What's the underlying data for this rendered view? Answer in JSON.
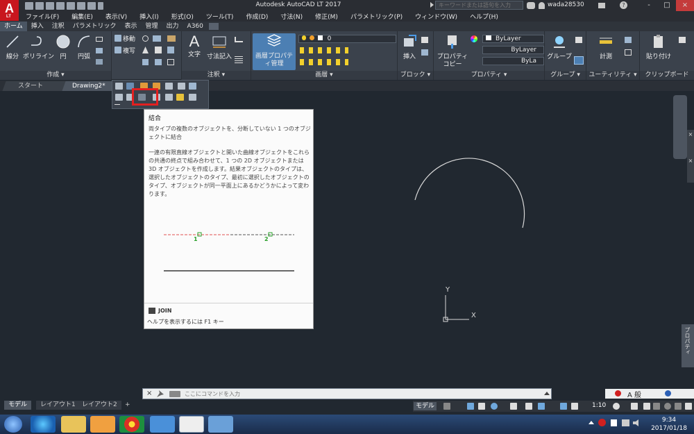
{
  "title_bar": {
    "app_logo": "A",
    "app_logo_sub": "LT",
    "window_title": "Autodesk AutoCAD LT 2017",
    "search_placeholder": "キーワードまたは語句を入力",
    "user_name": "wada28530",
    "window_controls": [
      "-",
      "□",
      "×"
    ]
  },
  "menu": [
    "ファイル(F)",
    "編集(E)",
    "表示(V)",
    "挿入(I)",
    "形式(O)",
    "ツール(T)",
    "作成(D)",
    "寸法(N)",
    "修正(M)",
    "パラメトリック(P)",
    "ウィンドウ(W)",
    "ヘルプ(H)"
  ],
  "ribbon_tabs": [
    "ホーム",
    "挿入",
    "注釈",
    "パラメトリック",
    "表示",
    "管理",
    "出力",
    "A360"
  ],
  "ribbon": {
    "draw": {
      "title": "作成 ▾",
      "tools": [
        "線分",
        "ポリライン",
        "円",
        "円弧"
      ]
    },
    "modify": {
      "move": "移動",
      "copy": "複写"
    },
    "annotation": {
      "title": "注釈 ▾",
      "text": "文字",
      "dimension": "寸法記入"
    },
    "layers": {
      "title": "画層 ▾",
      "layer_properties": "画層プロパティ管理",
      "current_layer": "0"
    },
    "block": {
      "title": "ブロック ▾",
      "insert": "挿入"
    },
    "properties": {
      "title": "プロパティ ▾",
      "copy_properties": "プロパティ コピー",
      "color": "ByLayer",
      "linetype": "ByLayer",
      "lineweight": "ByLa"
    },
    "group": {
      "title": "グループ ▾",
      "group": "グループ"
    },
    "utilities": {
      "title": "ユーティリティ ▾",
      "measure": "計測"
    },
    "clipboard": {
      "title": "クリップボード",
      "paste": "貼り付け"
    }
  },
  "doc_tabs": [
    "スタート",
    "Drawing2*"
  ],
  "tooltip": {
    "title": "結合",
    "summary": "両タイプの複数のオブジェクトを、分断していない 1 つのオブジェクトに結合",
    "description": "一連の有限直線オブジェクトと開いた曲線オブジェクトをこれらの共通の終点で組み合わせて、1 つの 2D オブジェクトまたは 3D オブジェクトを作成します。結果オブジェクトのタイプは、選択したオブジェクトのタイプ、最初に選択したオブジェクトのタイプ、オブジェクトが同一平面上にあるかどうかによって変わります。",
    "diagram_label_1": "1",
    "diagram_label_2": "2",
    "command": "JOIN",
    "help_hint": "ヘルプを表示するには F1 キー"
  },
  "ucs": {
    "x_label": "X",
    "y_label": "Y"
  },
  "right_palette_label": "プロパティ",
  "command_line": {
    "placeholder": "ここにコマンドを入力"
  },
  "layout_tabs": [
    "モデル",
    "レイアウト1",
    "レイアウト2",
    "+"
  ],
  "status_bar": {
    "model_button": "モデル",
    "scale": "1:10"
  },
  "tray_ime": "A 般",
  "clock": {
    "time": "9:34",
    "date": "2017/01/18"
  },
  "colors": {
    "canvas": "#212830",
    "ribbon": "#3b424c",
    "accent_highlight": "#e32020",
    "arc": "#d9d9d9",
    "diagram_red": "#e05050",
    "diagram_green": "#2aa02a"
  }
}
